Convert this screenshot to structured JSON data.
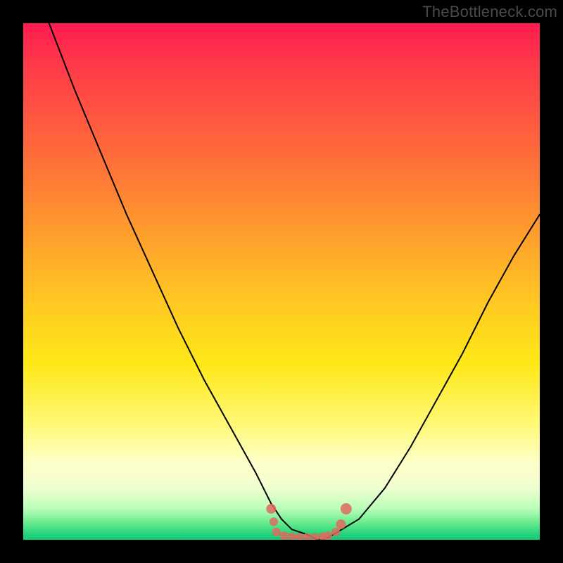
{
  "watermark": "TheBottleneck.com",
  "chart_data": {
    "type": "line",
    "title": "",
    "xlabel": "",
    "ylabel": "",
    "xlim": [
      0,
      100
    ],
    "ylim": [
      0,
      100
    ],
    "grid": false,
    "background": "heatmap-gradient",
    "series": [
      {
        "name": "bottleneck-curve",
        "x": [
          5,
          10,
          15,
          20,
          25,
          30,
          35,
          40,
          45,
          48,
          50,
          52,
          55,
          57,
          58,
          60,
          65,
          70,
          75,
          80,
          85,
          90,
          95,
          100
        ],
        "y": [
          100,
          87,
          75,
          63,
          52,
          41,
          31,
          22,
          13,
          7,
          4,
          2,
          1,
          0,
          0,
          1,
          4,
          10,
          18,
          27,
          36,
          46,
          55,
          63
        ],
        "color": "#000000",
        "stroke_width": 2
      }
    ],
    "markers": [
      {
        "name": "optimal-left-1",
        "x": 48.0,
        "y": 6.0,
        "color": "#e26a5d",
        "r": 7
      },
      {
        "name": "optimal-left-2",
        "x": 48.5,
        "y": 3.5,
        "color": "#e26a5d",
        "r": 6
      },
      {
        "name": "optimal-left-3",
        "x": 49.0,
        "y": 1.5,
        "color": "#e26a5d",
        "r": 6
      },
      {
        "name": "optimal-mid-1",
        "x": 50.5,
        "y": 0.8,
        "color": "#e26a5d",
        "r": 6
      },
      {
        "name": "optimal-mid-2",
        "x": 52.0,
        "y": 0.6,
        "color": "#e26a5d",
        "r": 6
      },
      {
        "name": "optimal-mid-3",
        "x": 53.5,
        "y": 0.5,
        "color": "#e26a5d",
        "r": 6
      },
      {
        "name": "optimal-mid-4",
        "x": 55.0,
        "y": 0.5,
        "color": "#e26a5d",
        "r": 6
      },
      {
        "name": "optimal-mid-5",
        "x": 56.5,
        "y": 0.5,
        "color": "#e26a5d",
        "r": 6
      },
      {
        "name": "optimal-mid-6",
        "x": 58.0,
        "y": 0.6,
        "color": "#e26a5d",
        "r": 6
      },
      {
        "name": "optimal-mid-7",
        "x": 59.0,
        "y": 0.8,
        "color": "#e26a5d",
        "r": 6
      },
      {
        "name": "optimal-right-1",
        "x": 60.5,
        "y": 1.5,
        "color": "#e26a5d",
        "r": 6
      },
      {
        "name": "optimal-right-2",
        "x": 61.5,
        "y": 3.0,
        "color": "#e26a5d",
        "r": 7
      },
      {
        "name": "optimal-right-3",
        "x": 62.5,
        "y": 6.0,
        "color": "#e26a5d",
        "r": 8
      }
    ]
  }
}
